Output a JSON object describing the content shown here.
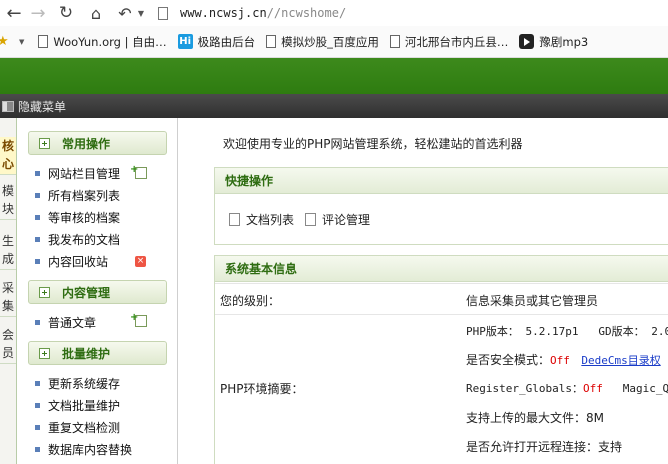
{
  "browser": {
    "url_host": "www.ncwsj.cn",
    "url_path": "//ncwshome/",
    "bookmarks": [
      {
        "label": "WooYun.org | 自由…",
        "icon": "page-icon"
      },
      {
        "label": "极路由后台",
        "icon": "hi-logo-icon"
      },
      {
        "label": "模拟炒股_百度应用",
        "icon": "page-icon"
      },
      {
        "label": "河北邢台市内丘县…",
        "icon": "page-icon"
      },
      {
        "label": "豫剧mp3",
        "icon": "play-icon"
      }
    ]
  },
  "menubar": {
    "label": "隐藏菜单"
  },
  "tabs": [
    {
      "label": "核心",
      "active": true
    },
    {
      "label": "模块",
      "active": false
    },
    {
      "label": "生成",
      "active": false
    },
    {
      "label": "采集",
      "active": false
    },
    {
      "label": "会员",
      "active": false
    }
  ],
  "sidebar": {
    "sections": [
      {
        "title": "常用操作",
        "items": [
          "网站栏目管理",
          "所有档案列表",
          "等审核的档案",
          "我发布的文档",
          "内容回收站"
        ]
      },
      {
        "title": "内容管理",
        "items": [
          "普通文章"
        ]
      },
      {
        "title": "批量维护",
        "items": [
          "更新系统缓存",
          "文档批量维护",
          "重复文档检测",
          "数据库内容替换"
        ]
      }
    ]
  },
  "main": {
    "welcome": "欢迎使用专业的PHP网站管理系统，轻松建站的首选利器",
    "quick": {
      "title": "快捷操作",
      "actions": [
        "文档列表",
        "评论管理"
      ]
    },
    "sysinfo": {
      "title": "系统基本信息",
      "level_label": "您的级别：",
      "level_value": "信息采集员或其它管理员",
      "env_label": "PHP环境摘要：",
      "php_version_label": "PHP版本：",
      "php_version": "5.2.17p1",
      "gd_label": "GD版本：",
      "gd_value": "2.0",
      "safe_mode_label": "是否安全模式：",
      "safe_mode_value": "Off",
      "dede_link": "DedeCms目录权",
      "register_globals_label": "Register_Globals：",
      "register_globals_value": "Off",
      "magic_quotes_label": "Magic_Quot",
      "max_upload_label": "支持上传的最大文件：",
      "max_upload_value": "8M",
      "remote_label": "是否允许打开远程连接：",
      "remote_value": "支持"
    }
  },
  "colors": {
    "brand_green": "#2e7c10",
    "section_text": "#2f6d12",
    "off_red": "#dd0000",
    "link_blue": "#1a3cc8"
  }
}
